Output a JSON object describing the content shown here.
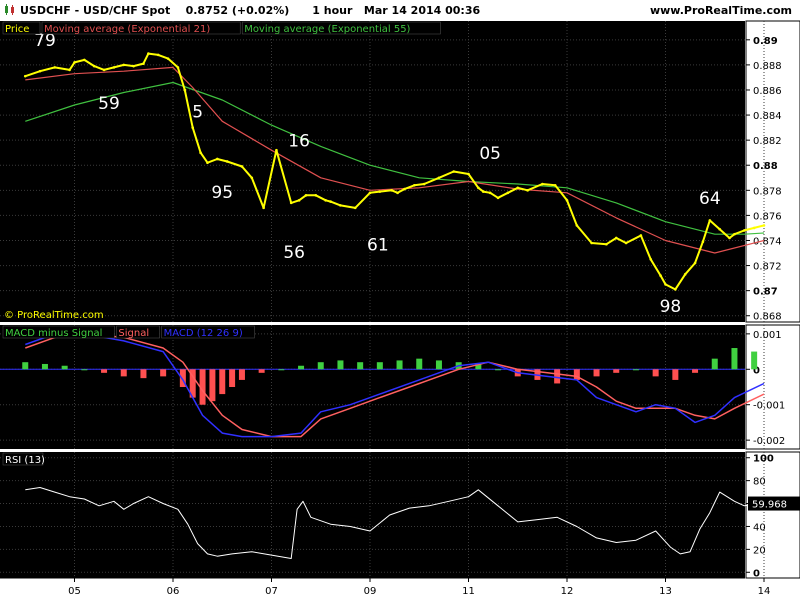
{
  "header": {
    "symbol": "USDCHF - USD/CHF Spot",
    "price": "0.8752 (+0.02%)",
    "interval": "1 hour",
    "datetime": "Mar 14 2014 00:36",
    "brand": "www.ProRealTime.com"
  },
  "watermark": "© ProRealTime.com",
  "colors": {
    "panel_bg": "#000000",
    "price": "#ffff00",
    "ema21": "#e05050",
    "ema55": "#40c040",
    "macd_line": "#3030ff",
    "signal_line": "#ff6060",
    "hist_pos": "#40d040",
    "hist_neg": "#ff5050",
    "rsi": "#ffffff"
  },
  "chart_data": [
    {
      "type": "line",
      "name": "price-panel",
      "legend": [
        {
          "label": "Price",
          "color": "#ffff00"
        },
        {
          "label": "Moving average (Exponential 21)",
          "color": "#e05050"
        },
        {
          "label": "Moving average (Exponential 55)",
          "color": "#40c040"
        }
      ],
      "ylim": [
        0.8675,
        0.8915
      ],
      "yticks": [
        0.868,
        0.87,
        0.872,
        0.874,
        0.876,
        0.878,
        0.88,
        0.882,
        0.884,
        0.886,
        0.888,
        0.89
      ],
      "ytick_labels": [
        "0.868",
        "0.87",
        "0.872",
        "0.874",
        "0.876",
        "0.878",
        "0.88",
        "0.882",
        "0.884",
        "0.886",
        "0.888",
        "0.89"
      ],
      "x_labels": [
        "05",
        "06",
        "07",
        "09",
        "11",
        "12",
        "13",
        "14"
      ],
      "x_label_pos": [
        0.5,
        1.5,
        2.5,
        3.5,
        4.5,
        5.5,
        6.5,
        7.5
      ],
      "grid": true,
      "price": {
        "x": [
          0,
          0.15,
          0.3,
          0.45,
          0.5,
          0.6,
          0.7,
          0.8,
          0.9,
          1.0,
          1.1,
          1.2,
          1.25,
          1.35,
          1.45,
          1.55,
          1.62,
          1.7,
          1.78,
          1.85,
          1.95,
          2.05,
          2.2,
          2.3,
          2.42,
          2.55,
          2.7,
          2.78,
          2.85,
          2.95,
          3.05,
          3.1,
          3.2,
          3.35,
          3.5,
          3.6,
          3.72,
          3.78,
          3.85,
          3.95,
          4.05,
          4.2,
          4.35,
          4.5,
          4.6,
          4.65,
          4.72,
          4.8,
          4.9,
          5.0,
          5.1,
          5.25,
          5.38,
          5.5,
          5.6,
          5.75,
          5.9,
          6.0,
          6.1,
          6.25,
          6.35,
          6.45,
          6.5,
          6.6,
          6.7,
          6.8,
          6.88,
          6.95,
          7.05,
          7.15,
          7.2,
          7.3,
          7.4,
          7.5
        ],
        "y": [
          0.8871,
          0.8875,
          0.8878,
          0.8876,
          0.8882,
          0.8884,
          0.8879,
          0.8876,
          0.8878,
          0.888,
          0.8879,
          0.8881,
          0.8889,
          0.8888,
          0.8885,
          0.8878,
          0.886,
          0.883,
          0.881,
          0.8802,
          0.8805,
          0.8803,
          0.8799,
          0.879,
          0.8766,
          0.8812,
          0.877,
          0.8772,
          0.8776,
          0.8776,
          0.8772,
          0.8771,
          0.8768,
          0.8766,
          0.8778,
          0.8779,
          0.878,
          0.8778,
          0.8781,
          0.8784,
          0.8785,
          0.879,
          0.8795,
          0.8793,
          0.8782,
          0.8779,
          0.8778,
          0.8774,
          0.8778,
          0.8782,
          0.878,
          0.8785,
          0.8784,
          0.8772,
          0.8752,
          0.8738,
          0.8737,
          0.8742,
          0.8738,
          0.8744,
          0.8725,
          0.8712,
          0.8705,
          0.8701,
          0.8713,
          0.8722,
          0.8739,
          0.8756,
          0.8749,
          0.8742,
          0.8745,
          0.8748,
          0.875,
          0.8752
        ]
      },
      "ema21": {
        "x": [
          0,
          0.5,
          1.0,
          1.5,
          1.7,
          2.0,
          2.5,
          3.0,
          3.5,
          4.0,
          4.5,
          5.0,
          5.5,
          6.0,
          6.5,
          7.0,
          7.5
        ],
        "y": [
          0.8868,
          0.8873,
          0.8875,
          0.8878,
          0.8862,
          0.8835,
          0.8812,
          0.879,
          0.878,
          0.8782,
          0.8787,
          0.8781,
          0.8778,
          0.8758,
          0.874,
          0.873,
          0.874
        ]
      },
      "ema55": {
        "x": [
          0,
          0.5,
          1.0,
          1.5,
          2.0,
          2.5,
          3.0,
          3.5,
          4.0,
          4.5,
          5.0,
          5.5,
          6.0,
          6.5,
          7.0,
          7.3,
          7.5
        ],
        "y": [
          0.8835,
          0.8848,
          0.8858,
          0.8866,
          0.8852,
          0.8832,
          0.8815,
          0.88,
          0.879,
          0.8787,
          0.8785,
          0.8782,
          0.877,
          0.8755,
          0.8745,
          0.8745,
          0.8746
        ]
      },
      "annotations": [
        {
          "text": "79",
          "x": 0.2,
          "y": 0.8895
        },
        {
          "text": "59",
          "x": 0.85,
          "y": 0.8845
        },
        {
          "text": "5",
          "x": 1.75,
          "y": 0.8838
        },
        {
          "text": "95",
          "x": 2.0,
          "y": 0.8774
        },
        {
          "text": "16",
          "x": 2.78,
          "y": 0.8815
        },
        {
          "text": "56",
          "x": 2.73,
          "y": 0.8726
        },
        {
          "text": "61",
          "x": 3.58,
          "y": 0.8732
        },
        {
          "text": "05",
          "x": 4.72,
          "y": 0.8805
        },
        {
          "text": "64",
          "x": 6.95,
          "y": 0.8769
        },
        {
          "text": "98",
          "x": 6.55,
          "y": 0.8683
        }
      ]
    },
    {
      "type": "line",
      "name": "macd-panel",
      "legend": [
        {
          "label": "MACD minus Signal",
          "color": "#40d040"
        },
        {
          "label": "Signal",
          "color": "#ff6060"
        },
        {
          "label": "MACD (12 26 9)",
          "color": "#3030ff"
        }
      ],
      "ylim": [
        -0.00225,
        0.00125
      ],
      "yticks": [
        0.001,
        0,
        -0.001,
        -0.002
      ],
      "ytick_labels": [
        "0.001",
        "0",
        "-0.001",
        "-0.002"
      ],
      "grid": true,
      "macd": {
        "x": [
          0,
          0.3,
          0.6,
          1.0,
          1.4,
          1.6,
          1.8,
          2.0,
          2.2,
          2.5,
          2.8,
          3.0,
          3.3,
          3.6,
          4.0,
          4.4,
          4.7,
          5.0,
          5.3,
          5.6,
          5.8,
          6.0,
          6.2,
          6.4,
          6.6,
          6.8,
          7.0,
          7.2,
          7.5
        ],
        "y": [
          0.0007,
          0.001,
          0.001,
          0.0008,
          0.0005,
          -0.0003,
          -0.0013,
          -0.0018,
          -0.0019,
          -0.0019,
          -0.0018,
          -0.0012,
          -0.001,
          -0.0007,
          -0.0003,
          0.0001,
          0.0002,
          -0.0001,
          -0.0002,
          -0.0003,
          -0.0008,
          -0.001,
          -0.0012,
          -0.001,
          -0.0011,
          -0.0015,
          -0.0013,
          -0.0008,
          -0.0004
        ]
      },
      "signal": {
        "x": [
          0,
          0.3,
          0.6,
          1.0,
          1.4,
          1.6,
          1.8,
          2.0,
          2.2,
          2.5,
          2.8,
          3.0,
          3.3,
          3.6,
          4.0,
          4.4,
          4.7,
          5.0,
          5.3,
          5.6,
          5.8,
          6.0,
          6.2,
          6.4,
          6.6,
          6.8,
          7.0,
          7.2,
          7.5
        ],
        "y": [
          0.0006,
          0.0009,
          0.001,
          0.0009,
          0.0006,
          0.0002,
          -0.0006,
          -0.0013,
          -0.0017,
          -0.0019,
          -0.0019,
          -0.0014,
          -0.0011,
          -0.0008,
          -0.0004,
          0.0,
          0.0002,
          0.0,
          -0.0001,
          -0.0002,
          -0.0005,
          -0.0009,
          -0.0011,
          -0.0011,
          -0.0011,
          -0.0013,
          -0.0014,
          -0.0011,
          -0.0007
        ]
      },
      "histogram": {
        "x": [
          0,
          0.2,
          0.4,
          0.6,
          0.8,
          1.0,
          1.2,
          1.4,
          1.6,
          1.7,
          1.8,
          1.9,
          2.0,
          2.1,
          2.2,
          2.4,
          2.6,
          2.8,
          3.0,
          3.2,
          3.4,
          3.6,
          3.8,
          4.0,
          4.2,
          4.4,
          4.6,
          4.8,
          5.0,
          5.2,
          5.4,
          5.6,
          5.8,
          6.0,
          6.2,
          6.4,
          6.6,
          6.8,
          7.0,
          7.2,
          7.4
        ],
        "y": [
          0.0002,
          0.00015,
          0.0001,
          0.0,
          -0.0001,
          -0.0002,
          -0.00025,
          -0.0002,
          -0.0005,
          -0.0008,
          -0.001,
          -0.0009,
          -0.0007,
          -0.0005,
          -0.0003,
          -0.0001,
          0.0,
          0.0001,
          0.0002,
          0.00025,
          0.0002,
          0.0002,
          0.00025,
          0.0003,
          0.00025,
          0.0002,
          0.00015,
          0.0,
          -0.0002,
          -0.0003,
          -0.0004,
          -0.0003,
          -0.0002,
          -0.0001,
          0.0,
          -0.0002,
          -0.0003,
          -0.0001,
          0.0003,
          0.0006,
          0.0005
        ]
      }
    },
    {
      "type": "line",
      "name": "rsi-panel",
      "legend": [
        {
          "label": "RSI (13)",
          "color": "#ffffff"
        }
      ],
      "ylim": [
        -5,
        105
      ],
      "yticks": [
        100,
        80,
        60,
        40,
        20,
        0
      ],
      "ytick_labels": [
        "100",
        "80",
        "60",
        "40",
        "20",
        "0"
      ],
      "last_value": "59.968",
      "grid": true,
      "rsi": {
        "x": [
          0,
          0.15,
          0.3,
          0.45,
          0.6,
          0.75,
          0.9,
          1.0,
          1.1,
          1.25,
          1.4,
          1.55,
          1.65,
          1.75,
          1.85,
          1.95,
          2.1,
          2.3,
          2.5,
          2.7,
          2.76,
          2.82,
          2.9,
          3.1,
          3.3,
          3.5,
          3.7,
          3.9,
          4.1,
          4.3,
          4.5,
          4.6,
          4.8,
          5.0,
          5.2,
          5.4,
          5.6,
          5.8,
          6.0,
          6.2,
          6.4,
          6.55,
          6.65,
          6.75,
          6.85,
          6.95,
          7.05,
          7.2,
          7.3,
          7.45
        ],
        "y": [
          72,
          74,
          70,
          66,
          64,
          58,
          62,
          55,
          60,
          66,
          60,
          55,
          42,
          25,
          16,
          14,
          16,
          18,
          15,
          12,
          55,
          62,
          48,
          42,
          40,
          36,
          50,
          56,
          58,
          62,
          66,
          72,
          58,
          44,
          46,
          48,
          40,
          30,
          26,
          28,
          36,
          22,
          16,
          18,
          38,
          52,
          70,
          62,
          58,
          60
        ]
      }
    }
  ]
}
